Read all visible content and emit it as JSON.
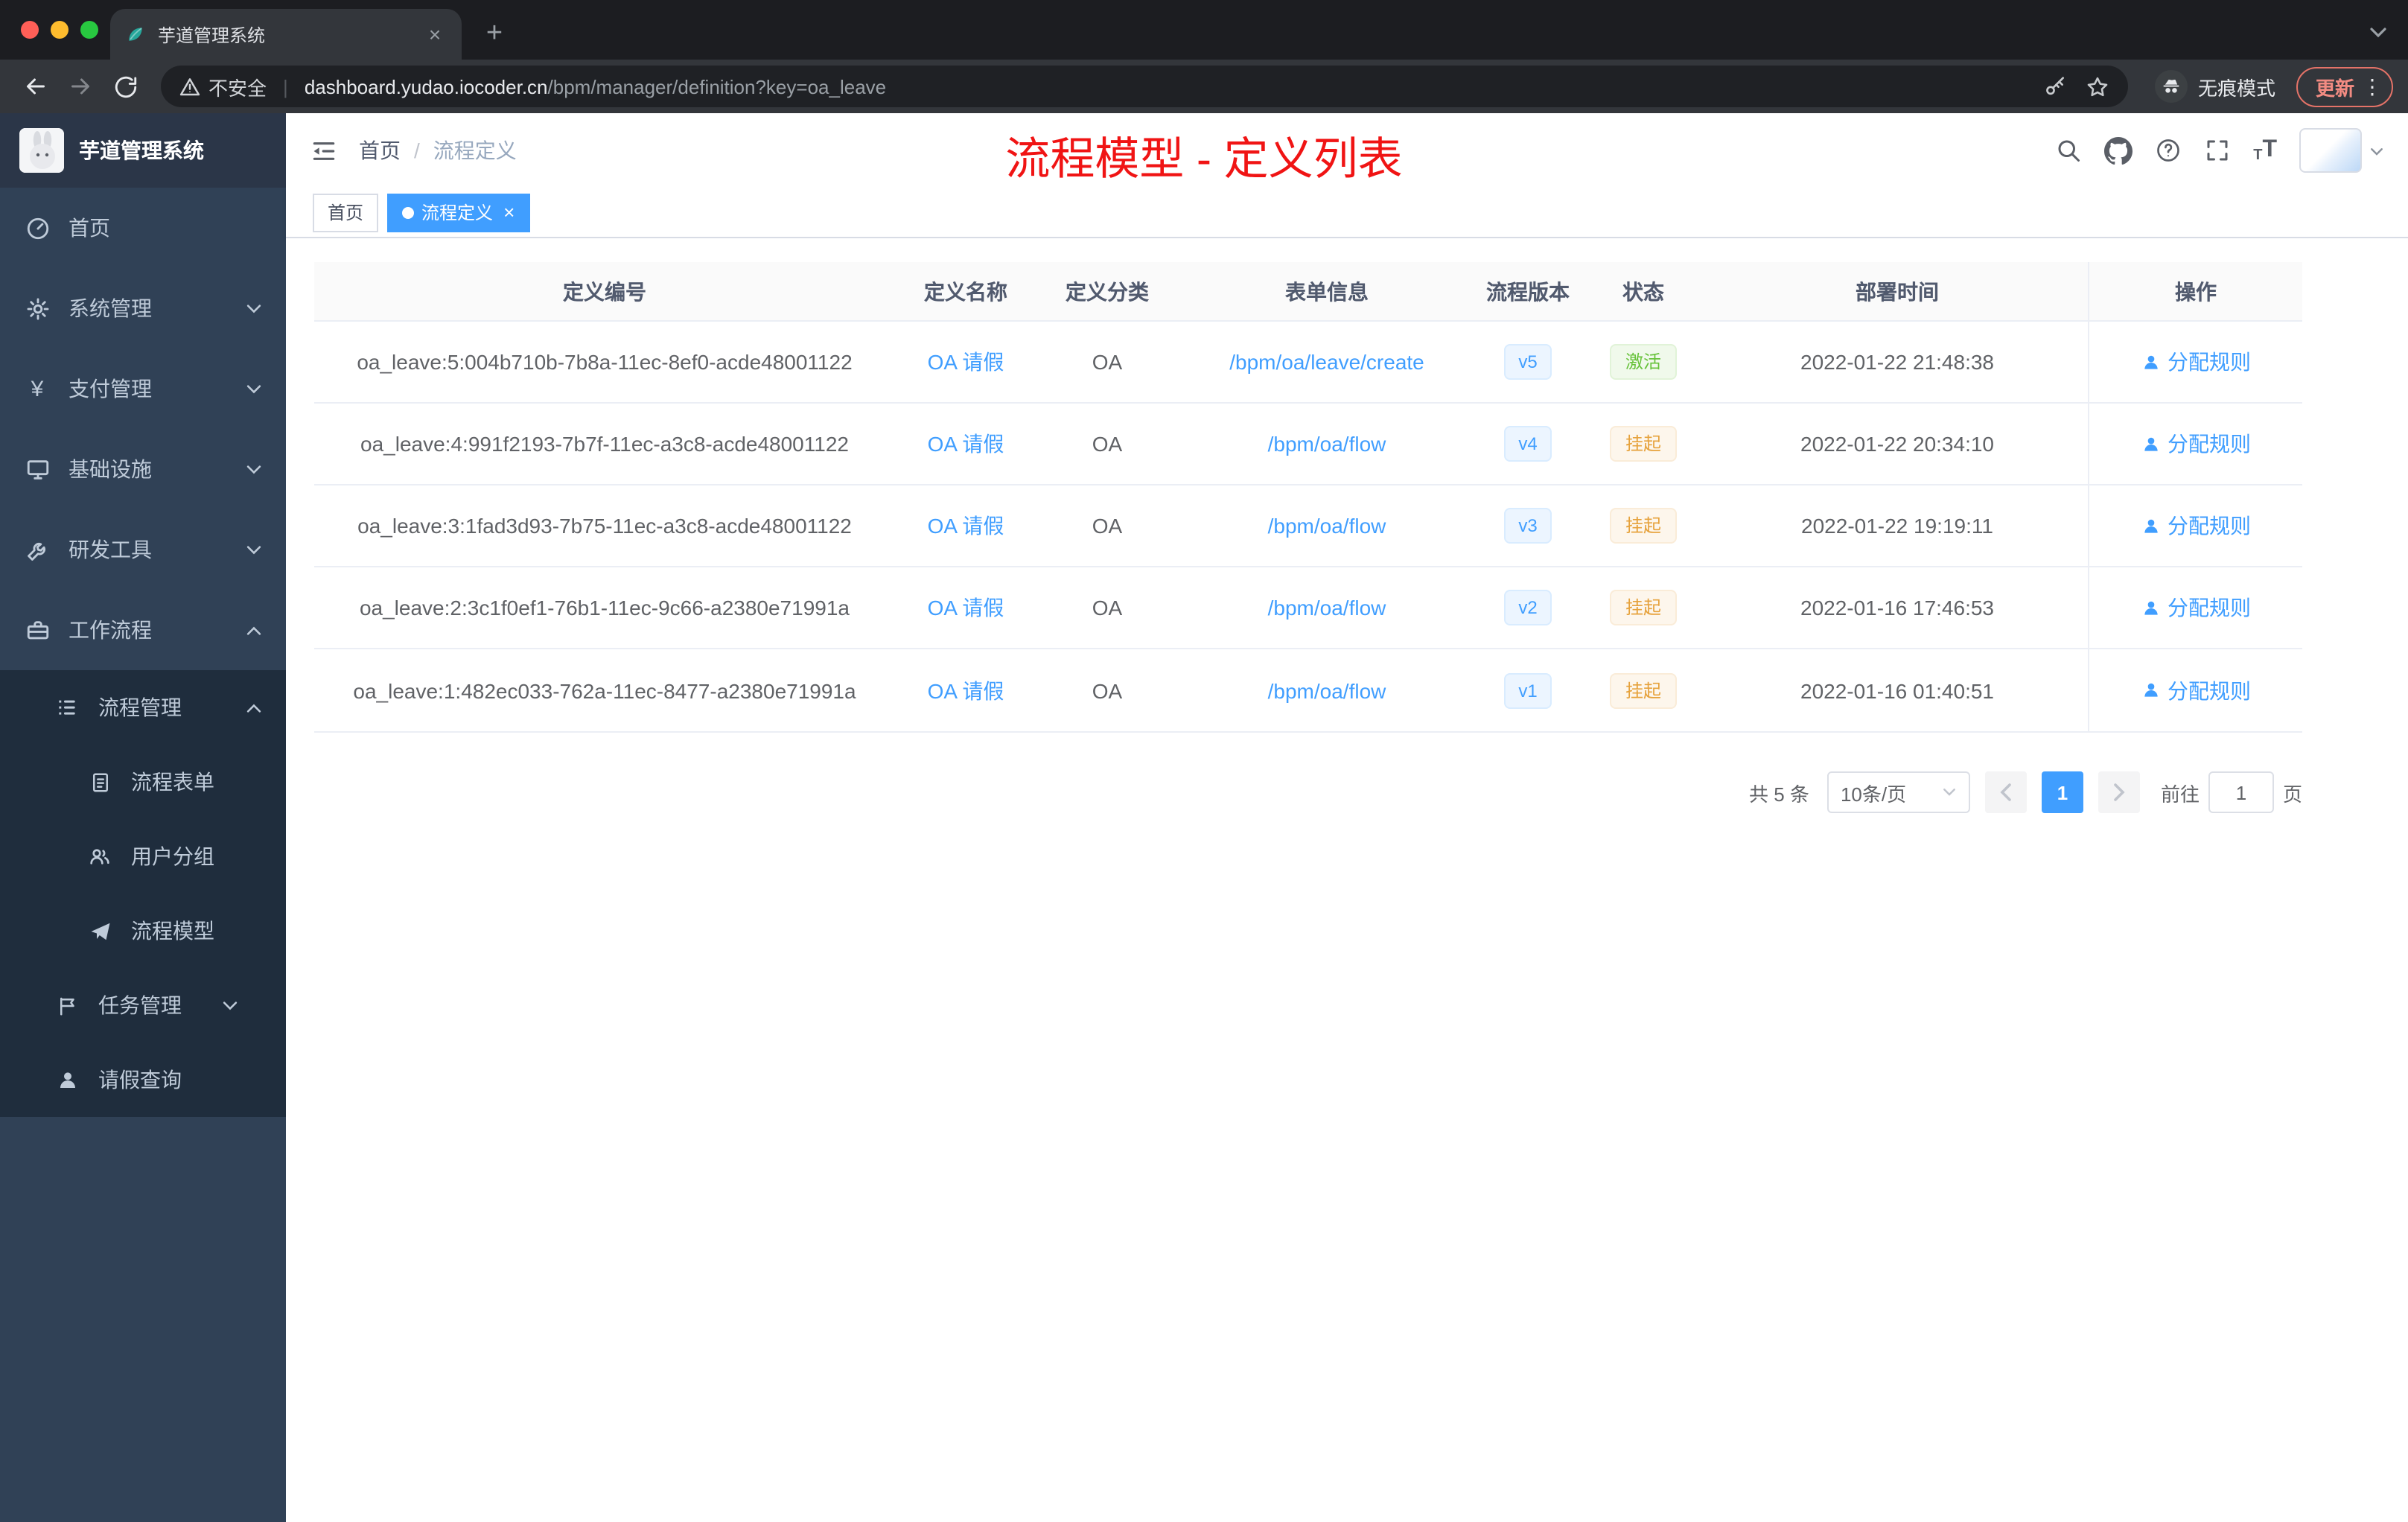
{
  "colors": {
    "accent": "#409eff",
    "success": "#67c23a",
    "warning": "#e6a23c",
    "red": "#f01414"
  },
  "browser": {
    "tab_title": "芋道管理系统",
    "security_label": "不安全",
    "url_host": "dashboard.yudao.iocoder.cn",
    "url_path": "/bpm/manager/definition?key=oa_leave",
    "incognito_label": "无痕模式",
    "update_label": "更新"
  },
  "sidebar": {
    "brand": "芋道管理系统",
    "items": [
      {
        "label": "首页"
      },
      {
        "label": "系统管理"
      },
      {
        "label": "支付管理"
      },
      {
        "label": "基础设施"
      },
      {
        "label": "研发工具"
      },
      {
        "label": "工作流程"
      }
    ],
    "submenu": {
      "process_mgmt": "流程管理",
      "process_form": "流程表单",
      "user_group": "用户分组",
      "process_model": "流程模型",
      "task_mgmt": "任务管理",
      "leave_query": "请假查询"
    }
  },
  "navbar": {
    "breadcrumb": [
      "首页",
      "流程定义"
    ],
    "annotation": "流程模型 - 定义列表"
  },
  "tags": [
    {
      "label": "首页",
      "active": false
    },
    {
      "label": "流程定义",
      "active": true
    }
  ],
  "table": {
    "headers": [
      "定义编号",
      "定义名称",
      "定义分类",
      "表单信息",
      "流程版本",
      "状态",
      "部署时间",
      "操作"
    ],
    "action_label": "分配规则",
    "rows": [
      {
        "id": "oa_leave:5:004b710b-7b8a-11ec-8ef0-acde48001122",
        "name": "OA 请假",
        "category": "OA",
        "form": "/bpm/oa/leave/create",
        "version": "v5",
        "status": "激活",
        "status_type": "success",
        "time": "2022-01-22 21:48:38"
      },
      {
        "id": "oa_leave:4:991f2193-7b7f-11ec-a3c8-acde48001122",
        "name": "OA 请假",
        "category": "OA",
        "form": "/bpm/oa/flow",
        "version": "v4",
        "status": "挂起",
        "status_type": "warning",
        "time": "2022-01-22 20:34:10"
      },
      {
        "id": "oa_leave:3:1fad3d93-7b75-11ec-a3c8-acde48001122",
        "name": "OA 请假",
        "category": "OA",
        "form": "/bpm/oa/flow",
        "version": "v3",
        "status": "挂起",
        "status_type": "warning",
        "time": "2022-01-22 19:19:11"
      },
      {
        "id": "oa_leave:2:3c1f0ef1-76b1-11ec-9c66-a2380e71991a",
        "name": "OA 请假",
        "category": "OA",
        "form": "/bpm/oa/flow",
        "version": "v2",
        "status": "挂起",
        "status_type": "warning",
        "time": "2022-01-16 17:46:53"
      },
      {
        "id": "oa_leave:1:482ec033-762a-11ec-8477-a2380e71991a",
        "name": "OA 请假",
        "category": "OA",
        "form": "/bpm/oa/flow",
        "version": "v1",
        "status": "挂起",
        "status_type": "warning",
        "time": "2022-01-16 01:40:51"
      }
    ]
  },
  "pagination": {
    "total": "共 5 条",
    "page_size": "10条/页",
    "current": "1",
    "goto_prefix": "前往",
    "goto_value": "1",
    "goto_suffix": "页"
  }
}
